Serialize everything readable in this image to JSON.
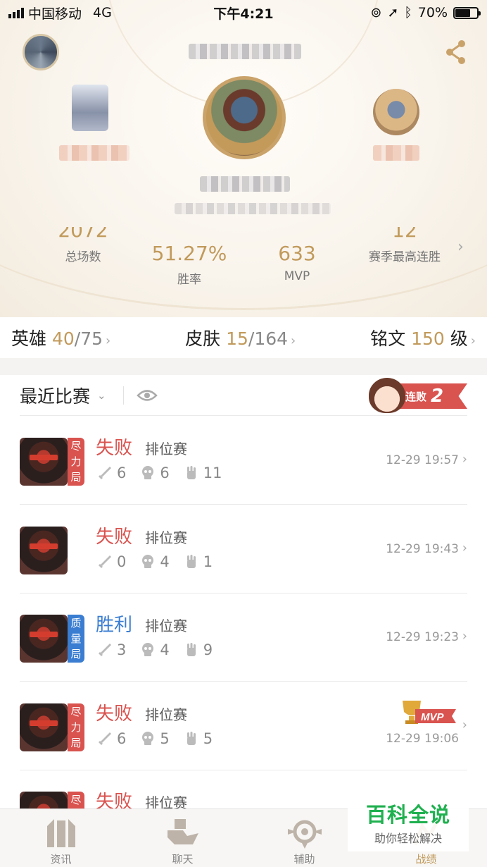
{
  "status_bar": {
    "carrier": "中国移动",
    "network": "4G",
    "time": "下午4:21",
    "battery": "70%",
    "battery_level": 0.7
  },
  "profile": {
    "total_matches_label": "总场数",
    "total_matches_value": "2072",
    "win_rate_value": "51.27%",
    "win_rate_label": "胜率",
    "mvp_value": "633",
    "mvp_label": "MVP",
    "best_streak_value": "12",
    "best_streak_label": "赛季最高连胜"
  },
  "collection": {
    "heroes": {
      "label": "英雄",
      "owned": "40",
      "total": "/75"
    },
    "skins": {
      "label": "皮肤",
      "owned": "15",
      "total": "/164"
    },
    "inscriptions": {
      "label": "铭文",
      "value": "150",
      "unit": "级"
    }
  },
  "recent": {
    "title": "最近比赛",
    "streak_label": "连败",
    "streak_count": "2"
  },
  "matches": [
    {
      "tag": "尽力局",
      "tag_color": "red",
      "result": "失败",
      "mode": "排位赛",
      "kills": "6",
      "deaths": "6",
      "assists": "11",
      "time": "12-29 19:57",
      "mvp": false
    },
    {
      "tag": "",
      "tag_color": "",
      "result": "失败",
      "mode": "排位赛",
      "kills": "0",
      "deaths": "4",
      "assists": "1",
      "time": "12-29 19:43",
      "mvp": false
    },
    {
      "tag": "质量局",
      "tag_color": "blue",
      "result": "胜利",
      "mode": "排位赛",
      "kills": "3",
      "deaths": "4",
      "assists": "9",
      "time": "12-29 19:23",
      "mvp": false
    },
    {
      "tag": "尽力局",
      "tag_color": "red",
      "result": "失败",
      "mode": "排位赛",
      "kills": "6",
      "deaths": "5",
      "assists": "5",
      "time": "12-29 19:06",
      "mvp": true,
      "mvp_label": "MVP"
    },
    {
      "tag": "尽",
      "tag_color": "red",
      "result": "失败",
      "mode": "排位赛"
    }
  ],
  "tabs": [
    {
      "label": "资讯",
      "icon": "news-icon"
    },
    {
      "label": "聊天",
      "icon": "chat-icon"
    },
    {
      "label": "辅助",
      "icon": "assist-icon"
    },
    {
      "label": "战绩",
      "icon": "record-icon",
      "active": true
    }
  ],
  "watermark": {
    "line1": "百科全说",
    "line2": "助你轻松解决"
  },
  "colors": {
    "gold": "#c19a5b",
    "loss": "#d9534f",
    "win": "#3a7dd1"
  }
}
